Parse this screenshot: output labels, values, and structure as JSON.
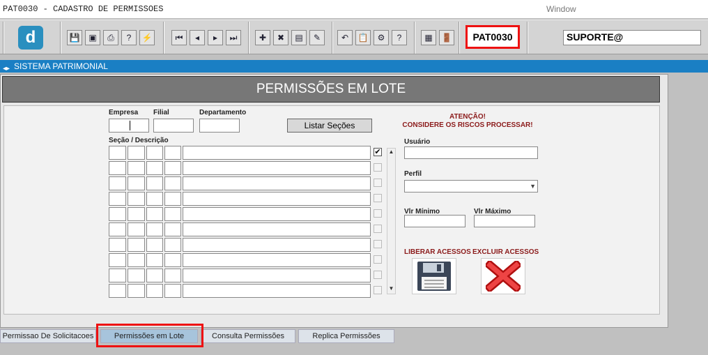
{
  "window": {
    "title": "PAT0030 - CADASTRO DE PERMISSOES",
    "window_menu": "Window"
  },
  "toolbar": {
    "program_code": "PAT0030",
    "user": "SUPORTE@"
  },
  "system_bar": {
    "label": "SISTEMA PATRIMONIAL"
  },
  "panel": {
    "title": "PERMISSÕES EM LOTE"
  },
  "form": {
    "empresa_label": "Empresa",
    "filial_label": "Filial",
    "departamento_label": "Departamento",
    "listar_button": "Listar Seções",
    "secao_label": "Seção / Descrição",
    "warning_line1": "ATENÇÃO!",
    "warning_line2": "CONSIDERE OS RISCOS PROCESSAR!",
    "usuario_label": "Usuário",
    "perfil_label": "Perfil",
    "vlr_min_label": "Vlr Mínimo",
    "vlr_max_label": "Vlr Máximo",
    "liberar_label": "LIBERAR ACESSOS",
    "excluir_label": "EXCLUIR ACESSOS",
    "rows_checked": [
      true,
      false,
      false,
      false,
      false,
      false,
      false,
      false,
      false,
      false
    ]
  },
  "tabs": [
    {
      "label": "Permissao De Solicitacoes",
      "active": false
    },
    {
      "label": "Permissões em Lote",
      "active": true
    },
    {
      "label": "Consulta Permissões",
      "active": false
    },
    {
      "label": "Replica Permissões",
      "active": false
    }
  ],
  "icons": {
    "logo": "d",
    "toolbar": [
      "save-icon",
      "window-icon",
      "print-icon",
      "help-query-icon",
      "run-icon",
      "first-record-icon",
      "prev-record-icon",
      "next-record-icon",
      "last-record-icon",
      "insert-icon",
      "delete-icon",
      "query-icon",
      "edit-icon",
      "undo-icon",
      "clipboard-icon",
      "tools-icon",
      "help-icon",
      "calculator-icon",
      "exit-icon"
    ]
  },
  "colors": {
    "highlight": "#e11111",
    "system_bar": "#1a7fc4",
    "warning": "#8b1a1a"
  }
}
